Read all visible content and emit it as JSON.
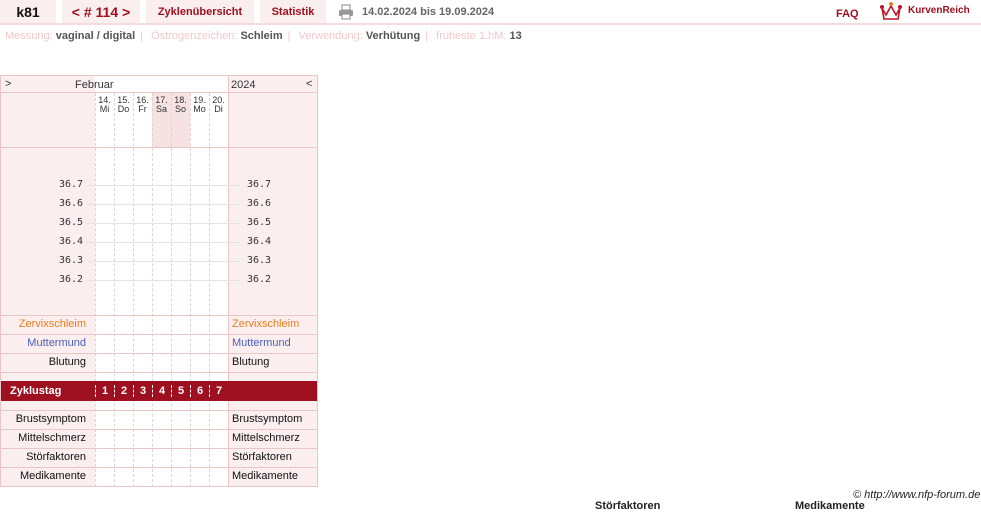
{
  "header": {
    "user": "k81",
    "cycle_nav": "< # 114 >",
    "tabs": [
      "Zyklenübersicht",
      "Statistik"
    ],
    "date_range": "14.02.2024 bis 19.09.2024",
    "faq": "FAQ",
    "brand": "KurvenReich"
  },
  "info": [
    {
      "label": "Messung:",
      "value": "vaginal / digital"
    },
    {
      "label": "Östrogenzeichen:",
      "value": "Schleim"
    },
    {
      "label": "Verwendung:",
      "value": "Verhütung"
    },
    {
      "label": "früheste 1.hM:",
      "value": "13"
    }
  ],
  "month_nav": {
    "prev": ">",
    "month": "Februar",
    "year": "2024",
    "next": "<"
  },
  "days": [
    {
      "date": "14.",
      "weekday": "Mi"
    },
    {
      "date": "15.",
      "weekday": "Do"
    },
    {
      "date": "16.",
      "weekday": "Fr"
    },
    {
      "date": "17.",
      "weekday": "Sa"
    },
    {
      "date": "18.",
      "weekday": "So"
    },
    {
      "date": "19.",
      "weekday": "Mo"
    },
    {
      "date": "20.",
      "weekday": "Di"
    }
  ],
  "chart_data": {
    "type": "line",
    "y_ticks": [
      "36.7",
      "36.6",
      "36.5",
      "36.4",
      "36.3",
      "36.2"
    ],
    "ylim": [
      36.2,
      36.7
    ],
    "series": [],
    "grid": true
  },
  "rows": {
    "cervical_mucus": "Zervixschleim",
    "cervix": "Muttermund",
    "bleeding": "Blutung",
    "cycle_day": "Zyklustag",
    "cycle_days": [
      "1",
      "2",
      "3",
      "4",
      "5",
      "6",
      "7"
    ],
    "breast_symptom": "Brustsymptom",
    "mittelschmerz": "Mittelschmerz",
    "disturbance": "Störfaktoren",
    "medication": "Medikamente"
  },
  "colors": {
    "accent": "#9e1020",
    "mucus": "#e87d1e",
    "cervix": "#4a5fbf",
    "pink_bg": "#fbeeee",
    "pink_border": "#e8c6c6"
  },
  "footer": {
    "copyright": "© http://www.nfp-forum.de",
    "cut_labels": [
      "Störfaktoren",
      "Medikamente"
    ]
  }
}
